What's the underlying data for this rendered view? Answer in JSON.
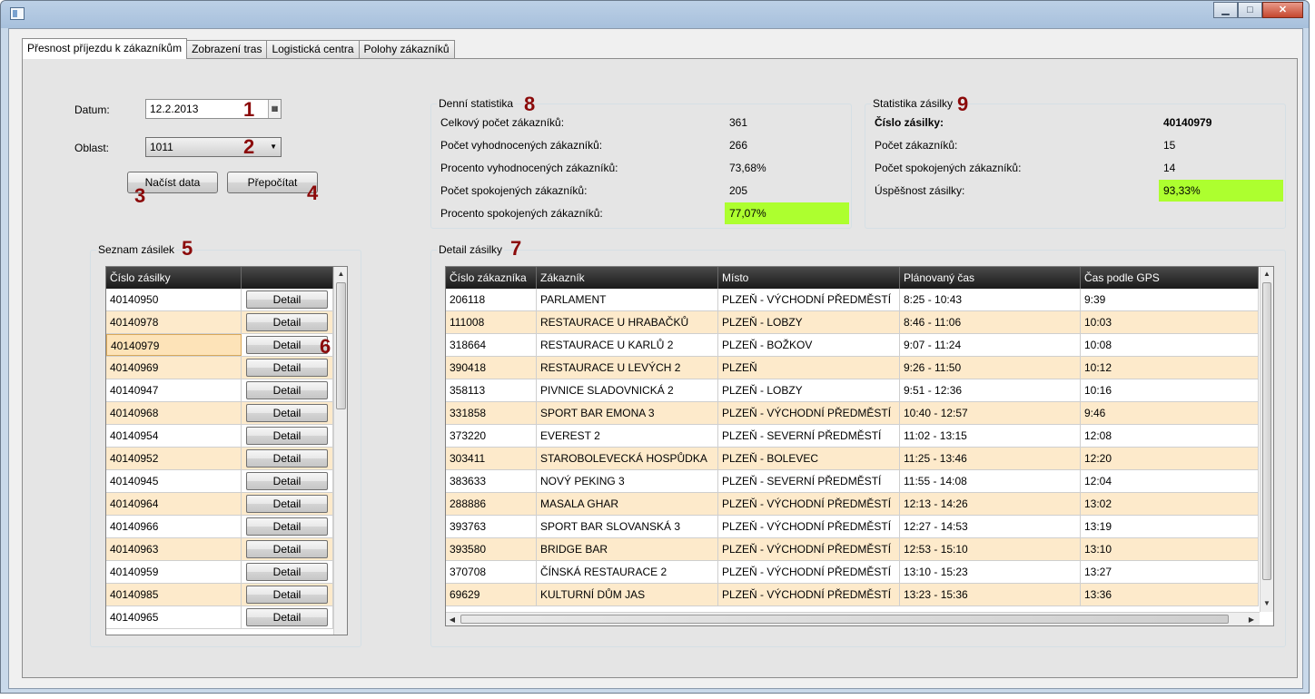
{
  "window": {
    "minimize": "▁",
    "maximize": "□",
    "close": "✕"
  },
  "tabs": [
    {
      "label": "Přesnost příjezdu k zákazníkům",
      "active": true
    },
    {
      "label": "Zobrazení tras"
    },
    {
      "label": "Logistická centra"
    },
    {
      "label": "Polohy zákazníků"
    }
  ],
  "filters": {
    "date_label": "Datum:",
    "date_value": "12.2.2013",
    "date_icon": "calendar-icon",
    "area_label": "Oblast:",
    "area_value": "1011",
    "load_button": "Načíst data",
    "recalc_button": "Přepočítat"
  },
  "markers": {
    "m1": "1",
    "m2": "2",
    "m3": "3",
    "m4": "4",
    "m5": "5",
    "m6": "6",
    "m7": "7",
    "m8": "8",
    "m9": "9"
  },
  "daily_stats": {
    "title": "Denní statistika",
    "rows": [
      {
        "label": "Celkový počet zákazníků:",
        "value": "361"
      },
      {
        "label": "Počet vyhodnocených zákazníků:",
        "value": "266"
      },
      {
        "label": "Procento vyhodnocených zákazníků:",
        "value": "73,68%"
      },
      {
        "label": "Počet spokojených zákazníků:",
        "value": "205"
      },
      {
        "label": "Procento spokojených zákazníků:",
        "value": "77,07%"
      }
    ]
  },
  "shipment_stats": {
    "title": "Statistika zásilky",
    "rows": [
      {
        "label": "Číslo zásilky:",
        "value": "40140979"
      },
      {
        "label": "Počet zákazníků:",
        "value": "15"
      },
      {
        "label": "Počet spokojených zákazníků:",
        "value": "14"
      },
      {
        "label": "Úspěšnost zásilky:",
        "value": "93,33%"
      }
    ]
  },
  "shipment_list": {
    "title": "Seznam zásilek",
    "header": "Číslo zásilky",
    "detail_label": "Detail",
    "rows": [
      "40140950",
      "40140978",
      "40140979",
      "40140969",
      "40140947",
      "40140968",
      "40140954",
      "40140952",
      "40140945",
      "40140964",
      "40140966",
      "40140963",
      "40140959",
      "40140985",
      "40140965"
    ]
  },
  "detail": {
    "title": "Detail zásilky",
    "headers": [
      "Číslo zákazníka",
      "Zákazník",
      "Místo",
      "Plánovaný čas",
      "Čas podle GPS"
    ],
    "rows": [
      [
        "206118",
        "PARLAMENT",
        "PLZEŇ - VÝCHODNÍ PŘEDMĚSTÍ",
        "8:25 - 10:43",
        "9:39"
      ],
      [
        "111008",
        "RESTAURACE U HRABAČKŮ",
        "PLZEŇ - LOBZY",
        "8:46 - 11:06",
        "10:03"
      ],
      [
        "318664",
        "RESTAURACE U KARLŮ 2",
        "PLZEŇ - BOŽKOV",
        "9:07 - 11:24",
        "10:08"
      ],
      [
        "390418",
        "RESTAURACE U LEVÝCH 2",
        "PLZEŇ",
        "9:26 - 11:50",
        "10:12"
      ],
      [
        "358113",
        "PIVNICE SLADOVNICKÁ 2",
        "PLZEŇ - LOBZY",
        "9:51 - 12:36",
        "10:16"
      ],
      [
        "331858",
        "SPORT BAR EMONA 3",
        "PLZEŇ - VÝCHODNÍ PŘEDMĚSTÍ",
        "10:40 - 12:57",
        "9:46"
      ],
      [
        "373220",
        "EVEREST 2",
        "PLZEŇ - SEVERNÍ PŘEDMĚSTÍ",
        "11:02 - 13:15",
        "12:08"
      ],
      [
        "303411",
        "STAROBOLEVECKÁ HOSPŮDKA",
        "PLZEŇ - BOLEVEC",
        "11:25 - 13:46",
        "12:20"
      ],
      [
        "383633",
        "NOVÝ PEKING 3",
        "PLZEŇ - SEVERNÍ PŘEDMĚSTÍ",
        "11:55 - 14:08",
        "12:04"
      ],
      [
        "288886",
        "MASALA GHAR",
        "PLZEŇ - VÝCHODNÍ PŘEDMĚSTÍ",
        "12:13 - 14:26",
        "13:02"
      ],
      [
        "393763",
        "SPORT BAR SLOVANSKÁ 3",
        "PLZEŇ - VÝCHODNÍ PŘEDMĚSTÍ",
        "12:27 - 14:53",
        "13:19"
      ],
      [
        "393580",
        "BRIDGE BAR",
        "PLZEŇ - VÝCHODNÍ PŘEDMĚSTÍ",
        "12:53 - 15:10",
        "13:10"
      ],
      [
        "370708",
        "ČÍNSKÁ RESTAURACE 2",
        "PLZEŇ - VÝCHODNÍ PŘEDMĚSTÍ",
        "13:10 - 15:23",
        "13:27"
      ],
      [
        "69629",
        "KULTURNÍ DŮM JAS",
        "PLZEŇ - VÝCHODNÍ PŘEDMĚSTÍ",
        "13:23 - 15:36",
        "13:36"
      ]
    ]
  },
  "colors": {
    "alt_row": "#fdeacb",
    "highlight": "#adff2f",
    "marker": "#8b0a0a"
  }
}
